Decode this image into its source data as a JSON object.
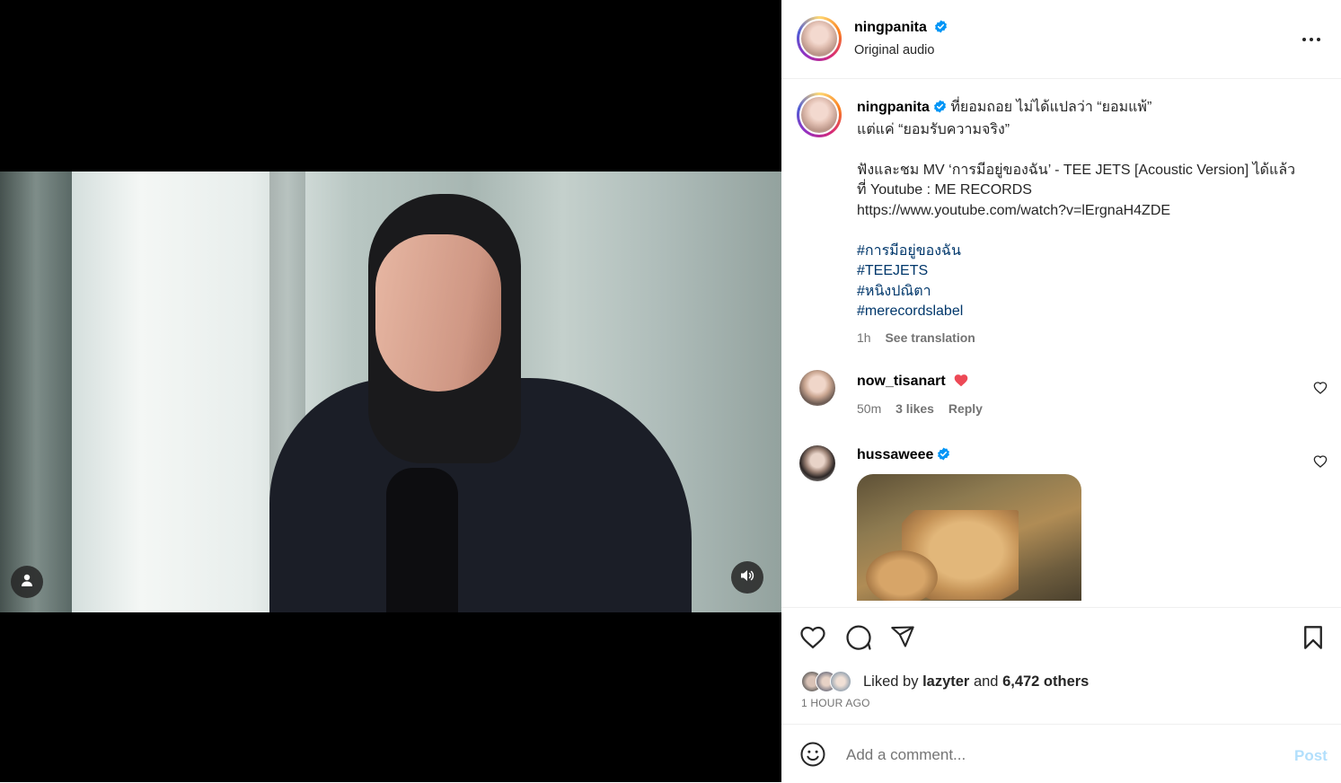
{
  "post": {
    "author": "ningpanita",
    "audio_label": "Original audio",
    "caption_lines": [
      "ที่ยอมถอย ไม่ได้แปลว่า “ยอมแพ้”",
      "แต่แค่ “ยอมรับความจริง”",
      "ฟังและชม MV ‘การมีอยู่ของฉัน’ - TEE JETS [Acoustic Version] ได้แล้ว",
      "ที่ Youtube : ME RECORDS",
      "https://www.youtube.com/watch?v=lErgnaH4ZDE"
    ],
    "hashtags": [
      "#การมีอยู่ของฉัน",
      "#TEEJETS",
      "#หนิงปณิตา",
      "#merecordslabel"
    ],
    "time": "1h",
    "see_translation": "See translation"
  },
  "comments": [
    {
      "user": "now_tisanart",
      "emoji": "❤️",
      "time": "50m",
      "likes": "3 likes",
      "reply": "Reply"
    },
    {
      "user": "hussaweee",
      "verified": true
    }
  ],
  "likes": {
    "prefix": "Liked by",
    "user": "lazyter",
    "conj": "and",
    "others": "6,472 others",
    "timestamp": "1 HOUR AGO"
  },
  "composer": {
    "placeholder": "Add a comment...",
    "post_label": "Post"
  },
  "icons": {
    "more": "more-options-icon",
    "like": "heart-icon",
    "comment": "comment-icon",
    "share": "share-icon",
    "save": "bookmark-icon",
    "emoji": "emoji-icon",
    "mute": "speaker-icon",
    "tagged_user": "user-icon"
  },
  "colors": {
    "verified": "#0095f6",
    "hashtag": "#00376b",
    "post_button": "#b2dffc",
    "heart_red": "#ed4956"
  }
}
